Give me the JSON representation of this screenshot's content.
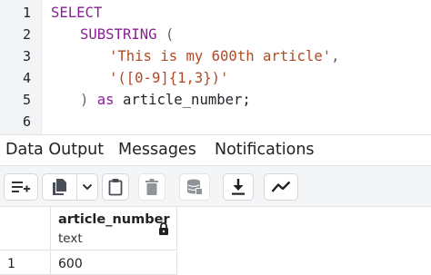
{
  "editor": {
    "line_numbers": [
      "1",
      "2",
      "3",
      "4",
      "5",
      "6"
    ],
    "lines": [
      {
        "keyword": "SELECT"
      },
      {
        "keyword": "SUBSTRING",
        "punct": " ("
      },
      {
        "string": "'This is my 600th article'",
        "punct": ","
      },
      {
        "string": "'([0-9]{1,3})'"
      },
      {
        "punct": ")",
        "keyword": "as",
        "text": "article_number;"
      },
      {}
    ]
  },
  "tabs": {
    "data_output": "Data Output",
    "messages": "Messages",
    "notifications": "Notifications"
  },
  "toolbar": {
    "icons": [
      "add-row-icon",
      "copy-icon",
      "dropdown-chevron-icon",
      "paste-icon",
      "delete-icon",
      "save-data-icon",
      "download-icon",
      "graph-visualiser-icon"
    ]
  },
  "grid": {
    "columns": [
      {
        "name": "article_number",
        "type": "text",
        "locked": true
      }
    ],
    "rows": [
      {
        "row_number": "1",
        "cells": [
          "600"
        ]
      }
    ]
  }
}
